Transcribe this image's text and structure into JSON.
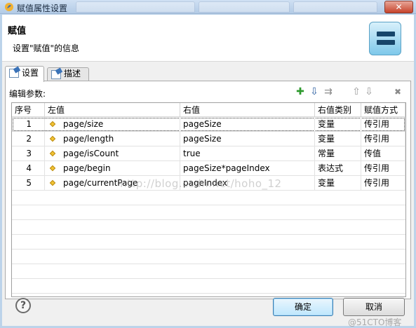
{
  "window": {
    "title": "赋值属性设置",
    "close_label": "✕"
  },
  "header": {
    "title": "赋值",
    "description": "设置\"赋值\"的信息",
    "icon": "assignment-equals-icon"
  },
  "tabs": [
    {
      "label": "设置",
      "icon": "settings-tab-icon",
      "active": true
    },
    {
      "label": "描述",
      "icon": "description-tab-icon",
      "active": false
    }
  ],
  "params": {
    "label": "编辑参数:",
    "toolbar": [
      {
        "name": "add-icon",
        "glyph": "✚"
      },
      {
        "name": "import-icon",
        "glyph": "⇩"
      },
      {
        "name": "insert-icon",
        "glyph": "⇉"
      },
      {
        "name": "move-up-icon",
        "glyph": "⇧"
      },
      {
        "name": "move-down-icon",
        "glyph": "⇩"
      },
      {
        "name": "delete-icon",
        "glyph": "✖"
      }
    ]
  },
  "table": {
    "columns": [
      "序号",
      "左值",
      "右值",
      "右值类别",
      "赋值方式"
    ],
    "rows": [
      {
        "no": "1",
        "left": "page/size",
        "right": "pageSize",
        "type": "变量",
        "mode": "传引用"
      },
      {
        "no": "2",
        "left": "page/length",
        "right": "pageSize",
        "type": "变量",
        "mode": "传引用"
      },
      {
        "no": "3",
        "left": "page/isCount",
        "right": "true",
        "type": "常量",
        "mode": "传值"
      },
      {
        "no": "4",
        "left": "page/begin",
        "right": "pageSize*pageIndex",
        "type": "表达式",
        "mode": "传引用"
      },
      {
        "no": "5",
        "left": "page/currentPage",
        "right": "pageIndex",
        "type": "变量",
        "mode": "传引用"
      }
    ]
  },
  "footer": {
    "help_label": "?",
    "ok_label": "确定",
    "cancel_label": "取消"
  },
  "watermarks": {
    "middle": "http://blog.csdn.net/hoho_12",
    "corner": "@51CTO博客"
  },
  "colors": {
    "accent": "#3c7fb1",
    "diamond": "#f1c232"
  }
}
